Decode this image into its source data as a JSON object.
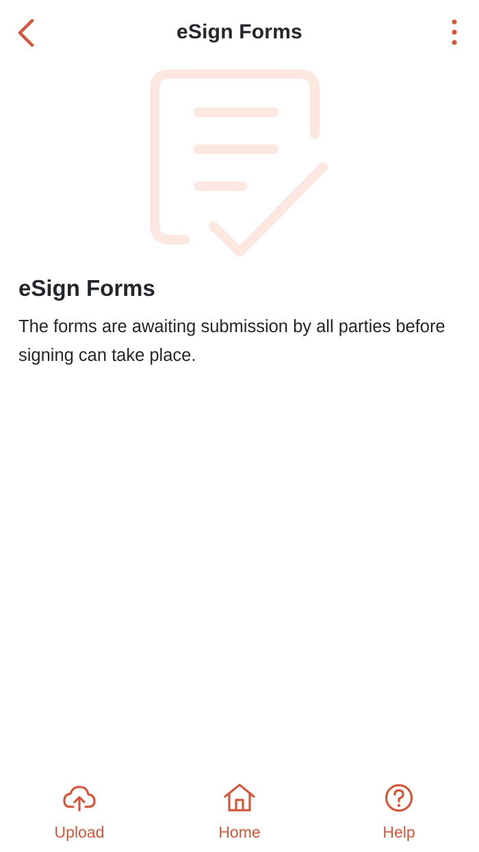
{
  "colors": {
    "accent": "#d4573b",
    "illustration": "#fce7e1",
    "text": "#23262b"
  },
  "header": {
    "title": "eSign Forms",
    "back_icon": "chevron-left-icon",
    "menu_icon": "more-vertical-icon"
  },
  "main": {
    "illustration_icon": "document-check-icon",
    "title": "eSign Forms",
    "description": "The forms are awaiting submission by all parties before signing can take place."
  },
  "bottom_nav": {
    "items": [
      {
        "label": "Upload",
        "icon": "cloud-upload-icon"
      },
      {
        "label": "Home",
        "icon": "home-icon"
      },
      {
        "label": "Help",
        "icon": "help-circle-icon"
      }
    ]
  }
}
